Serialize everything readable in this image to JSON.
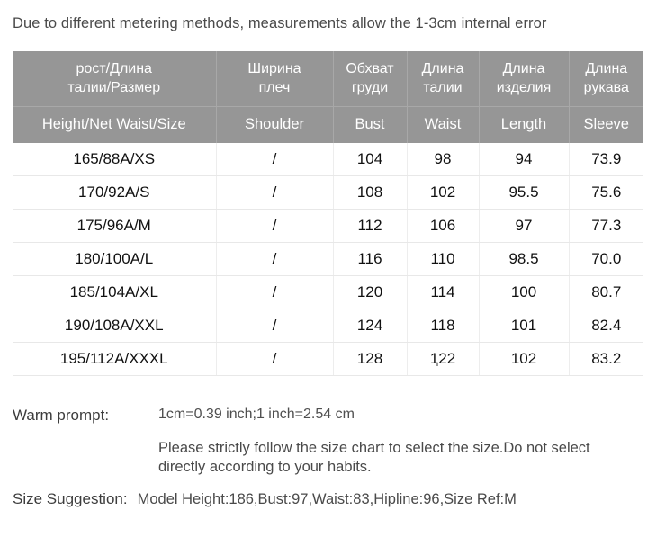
{
  "top_note": "Due to different metering methods, measurements allow the 1-3cm internal error",
  "table": {
    "headers_ru": [
      [
        "рост/Длина",
        "талии/Размер"
      ],
      [
        "Ширина",
        "плеч"
      ],
      [
        "Обхват",
        "груди"
      ],
      [
        "Длина",
        "талии"
      ],
      [
        "Длина",
        "изделия"
      ],
      [
        "Длина",
        "рукава"
      ]
    ],
    "headers_en": [
      "Height/Net  Waist/Size",
      "Shoulder",
      "Bust",
      "Waist",
      "Length",
      "Sleeve"
    ],
    "rows": [
      {
        "size": "165/88A/XS",
        "shoulder": "/",
        "bust": "104",
        "waist": "98",
        "length": "94",
        "sleeve": "73.9"
      },
      {
        "size": "170/92A/S",
        "shoulder": "/",
        "bust": "108",
        "waist": "102",
        "length": "95.5",
        "sleeve": "75.6"
      },
      {
        "size": "175/96A/M",
        "shoulder": "/",
        "bust": "112",
        "waist": "106",
        "length": "97",
        "sleeve": "77.3"
      },
      {
        "size": "180/100A/L",
        "shoulder": "/",
        "bust": "116",
        "waist": "110",
        "length": "98.5",
        "sleeve": "70.0"
      },
      {
        "size": "185/104A/XL",
        "shoulder": "/",
        "bust": "120",
        "waist": "114",
        "length": "100",
        "sleeve": "80.7"
      },
      {
        "size": "190/108A/XXL",
        "shoulder": "/",
        "bust": "124",
        "waist": "118",
        "length": "101",
        "sleeve": "82.4"
      },
      {
        "size": "195/112A/XXXL",
        "shoulder": "/",
        "bust": "128",
        "waist": "122",
        "length": "102",
        "sleeve": "83.2"
      }
    ],
    "header_bg": "#969696",
    "header_text_color": "#ffffff"
  },
  "footer": {
    "warm_prompt_label": "Warm prompt:",
    "warm_prompt_line1": "1cm=0.39 inch;1 inch=2.54 cm",
    "warm_prompt_line2": "Please strictly follow the size chart  to select the size.Do not select directly according to your habits.",
    "size_suggestion_label": "Size Suggestion:",
    "size_suggestion_value": "Model Height:186,Bust:97,Waist:83,Hipline:96,Size Ref:M"
  }
}
